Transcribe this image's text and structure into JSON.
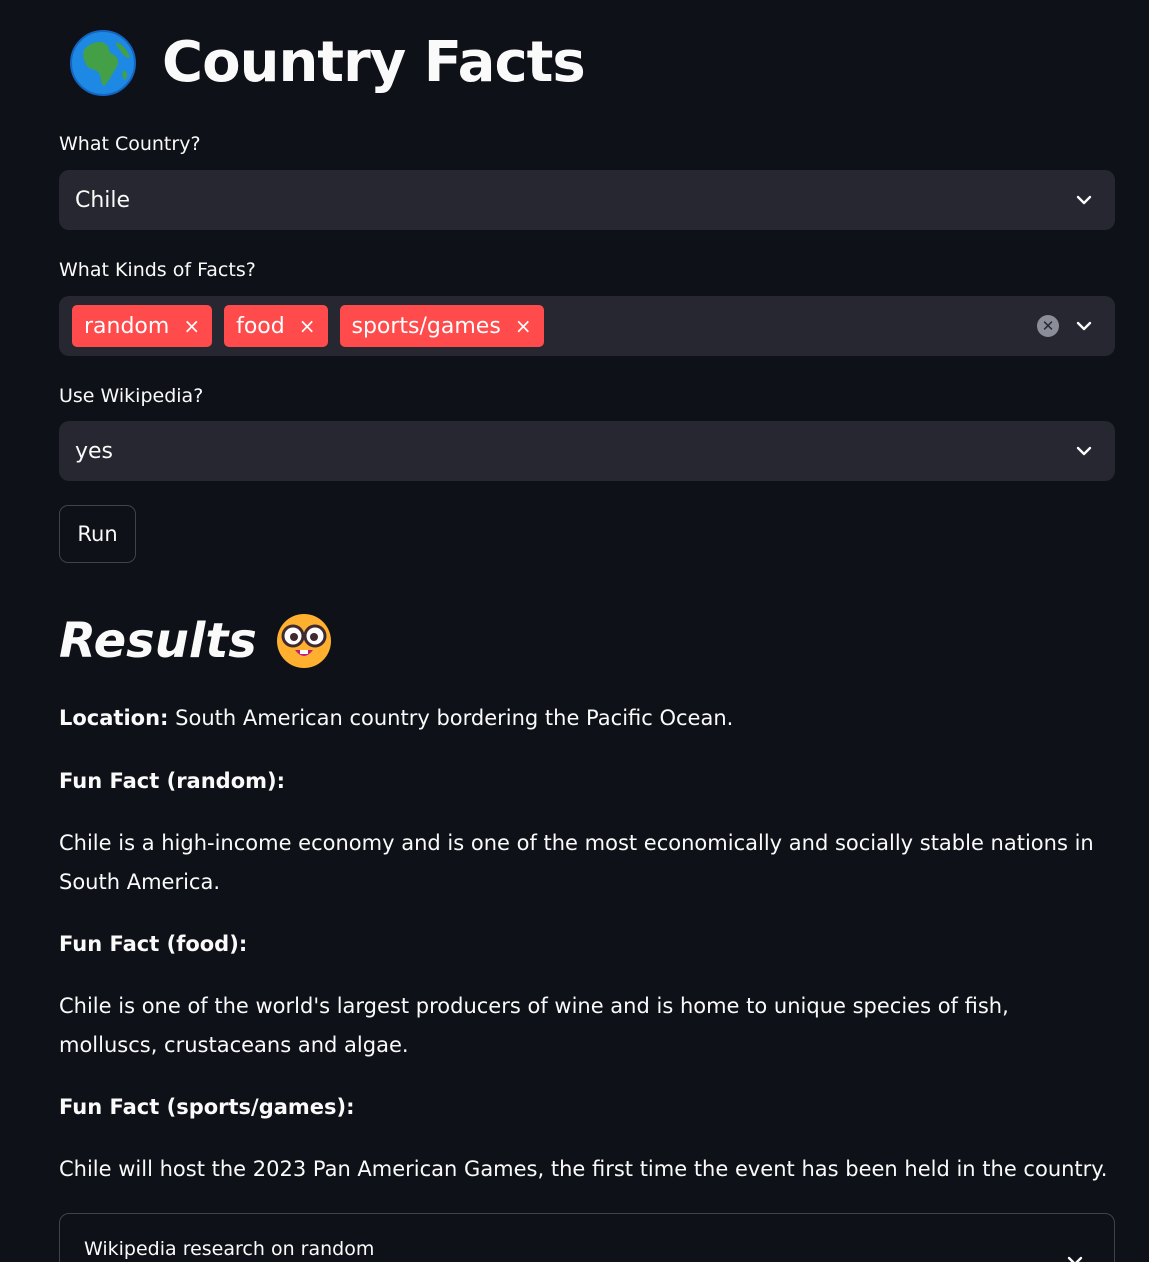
{
  "header": {
    "title": "Country Facts",
    "icon": "globe-africa-icon"
  },
  "form": {
    "country_label": "What Country?",
    "country_value": "Chile",
    "facts_label": "What Kinds of Facts?",
    "facts_tags": [
      "random",
      "food",
      "sports/games"
    ],
    "tag_remove_glyph": "×",
    "clear_glyph": "✕",
    "wiki_label": "Use Wikipedia?",
    "wiki_value": "yes",
    "run_label": "Run"
  },
  "results": {
    "heading": "Results",
    "heading_icon": "nerd-face-icon",
    "location_label": "Location:",
    "location_text": "South American country bordering the Pacific Ocean.",
    "fact_random_heading": "Fun Fact (random):",
    "fact_random_text": "Chile is a high-income economy and is one of the most economically and socially stable nations in South America.",
    "fact_food_heading": "Fun Fact (food):",
    "fact_food_text": "Chile is one of the world's largest producers of wine and is home to unique species of fish, molluscs, crustaceans and algae.",
    "fact_sports_heading": "Fun Fact (sports/games):",
    "fact_sports_text": "Chile will host the 2023 Pan American Games, the first time the event has been held in the country.",
    "expander_label": "Wikipedia research on random"
  },
  "colors": {
    "background": "#0e1117",
    "input_bg": "#262730",
    "accent": "#ff4b4b",
    "border": "#40424c"
  }
}
